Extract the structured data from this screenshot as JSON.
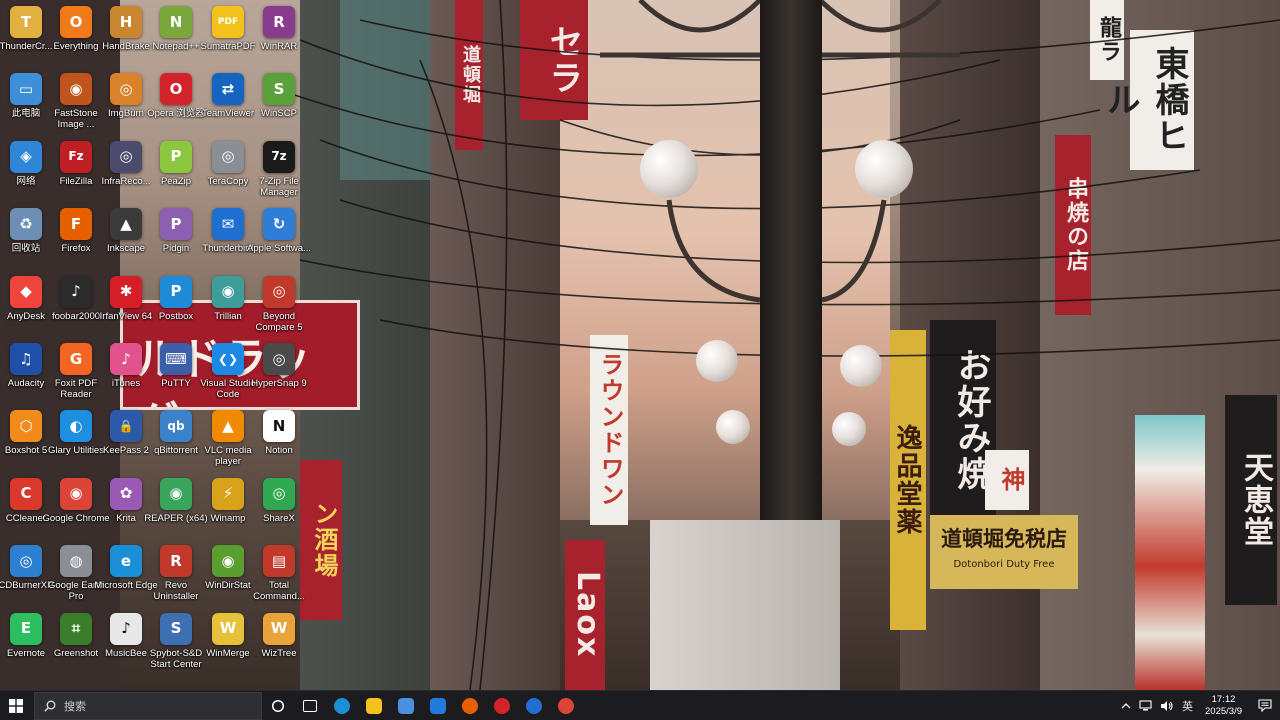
{
  "desktop": {
    "icons": [
      {
        "name": "ThunderCr...",
        "icon": "thundercr-icon",
        "color": "#e0b040",
        "glyph": "T"
      },
      {
        "name": "Everything",
        "icon": "everything-icon",
        "color": "#f07a1a",
        "glyph": "O"
      },
      {
        "name": "HandBrake",
        "icon": "handbrake-icon",
        "color": "#c9862f",
        "glyph": "H"
      },
      {
        "name": "Notepad++",
        "icon": "notepadpp-icon",
        "color": "#7aa83c",
        "glyph": "N"
      },
      {
        "name": "SumatraPDF",
        "icon": "sumatrapdf-icon",
        "color": "#f2c21b",
        "glyph": "PDF"
      },
      {
        "name": "WinRAR",
        "icon": "winrar-icon",
        "color": "#8a3c8c",
        "glyph": "R"
      },
      {
        "name": "此电脑",
        "icon": "this-pc-icon",
        "color": "#3f8fd8",
        "glyph": "▭"
      },
      {
        "name": "FastStone Image ...",
        "icon": "faststone-icon",
        "color": "#c0541e",
        "glyph": "◉"
      },
      {
        "name": "ImgBurn",
        "icon": "imgburn-icon",
        "color": "#d9822b",
        "glyph": "◎"
      },
      {
        "name": "Opera 浏览器",
        "icon": "opera-icon",
        "color": "#d2232a",
        "glyph": "O"
      },
      {
        "name": "TeamViewer",
        "icon": "teamviewer-icon",
        "color": "#1565c0",
        "glyph": "⇄"
      },
      {
        "name": "WinSCP",
        "icon": "winscp-icon",
        "color": "#5aa13c",
        "glyph": "S"
      },
      {
        "name": "网络",
        "icon": "network-icon",
        "color": "#2f86d6",
        "glyph": "◈"
      },
      {
        "name": "FileZilla",
        "icon": "filezilla-icon",
        "color": "#bf1e24",
        "glyph": "Fz"
      },
      {
        "name": "InfraReco...",
        "icon": "infrarecorder-icon",
        "color": "#4b4b6e",
        "glyph": "◎"
      },
      {
        "name": "PeaZip",
        "icon": "peazip-icon",
        "color": "#8cc63f",
        "glyph": "P"
      },
      {
        "name": "TeraCopy",
        "icon": "teracopy-icon",
        "color": "#8a8f96",
        "glyph": "◎"
      },
      {
        "name": "7-Zip File Manager",
        "icon": "sevenzip-icon",
        "color": "#1a1a1a",
        "glyph": "7z"
      },
      {
        "name": "回收站",
        "icon": "recycle-bin-icon",
        "color": "#6c8fb3",
        "glyph": "♻"
      },
      {
        "name": "Firefox",
        "icon": "firefox-icon",
        "color": "#e66000",
        "glyph": "F"
      },
      {
        "name": "Inkscape",
        "icon": "inkscape-icon",
        "color": "#3a3a3a",
        "glyph": "▲"
      },
      {
        "name": "Pidgin",
        "icon": "pidgin-icon",
        "color": "#8d5fb0",
        "glyph": "P"
      },
      {
        "name": "Thunderbird",
        "icon": "thunderbird-icon",
        "color": "#1f6fd0",
        "glyph": "✉"
      },
      {
        "name": "Apple Softwa...",
        "icon": "apple-software-update-icon",
        "color": "#2e7dd7",
        "glyph": "↻"
      },
      {
        "name": "AnyDesk",
        "icon": "anydesk-icon",
        "color": "#ef443b",
        "glyph": "◆"
      },
      {
        "name": "foobar2000",
        "icon": "foobar2000-icon",
        "color": "#2b2b2b",
        "glyph": "♪"
      },
      {
        "name": "IrfanView 64",
        "icon": "irfanview-icon",
        "color": "#d31f25",
        "glyph": "✱"
      },
      {
        "name": "Postbox",
        "icon": "postbox-icon",
        "color": "#1f8ad6",
        "glyph": "P"
      },
      {
        "name": "Trillian",
        "icon": "trillian-icon",
        "color": "#3e9c9a",
        "glyph": "◉"
      },
      {
        "name": "Beyond Compare 5",
        "icon": "beyond-compare-icon",
        "color": "#c0392b",
        "glyph": "◎"
      },
      {
        "name": "Audacity",
        "icon": "audacity-icon",
        "color": "#1f4fa8",
        "glyph": "♫"
      },
      {
        "name": "Foxit PDF Reader",
        "icon": "foxit-icon",
        "color": "#f26522",
        "glyph": "G"
      },
      {
        "name": "iTunes",
        "icon": "itunes-icon",
        "color": "#e2538e",
        "glyph": "♪"
      },
      {
        "name": "PuTTY",
        "icon": "putty-icon",
        "color": "#3c5fa8",
        "glyph": "⌨"
      },
      {
        "name": "Visual Studio Code",
        "icon": "vscode-icon",
        "color": "#1e88e5",
        "glyph": "❮❯"
      },
      {
        "name": "HyperSnap 9",
        "icon": "hypersnap-icon",
        "color": "#4a4a4a",
        "glyph": "◎"
      },
      {
        "name": "Boxshot 5",
        "icon": "boxshot-icon",
        "color": "#f08c1e",
        "glyph": "⬡"
      },
      {
        "name": "Glary Utilities",
        "icon": "glary-utilities-icon",
        "color": "#1c8fe0",
        "glyph": "◐"
      },
      {
        "name": "KeePass 2",
        "icon": "keepass-icon",
        "color": "#2c5aa8",
        "glyph": "🔒"
      },
      {
        "name": "qBittorrent",
        "icon": "qbittorrent-icon",
        "color": "#3b82c8",
        "glyph": "qb"
      },
      {
        "name": "VLC media player",
        "icon": "vlc-icon",
        "color": "#f08a00",
        "glyph": "▲"
      },
      {
        "name": "Notion",
        "icon": "notion-icon",
        "color": "#ffffff",
        "glyph": "N"
      },
      {
        "name": "CCleaner",
        "icon": "ccleaner-icon",
        "color": "#d9382b",
        "glyph": "C"
      },
      {
        "name": "Google Chrome",
        "icon": "chrome-icon",
        "color": "#db4437",
        "glyph": "◉"
      },
      {
        "name": "Krita",
        "icon": "krita-icon",
        "color": "#9b59b6",
        "glyph": "✿"
      },
      {
        "name": "REAPER (x64)",
        "icon": "reaper-icon",
        "color": "#3aa55c",
        "glyph": "◉"
      },
      {
        "name": "Winamp",
        "icon": "winamp-icon",
        "color": "#d9a21b",
        "glyph": "⚡"
      },
      {
        "name": "ShareX",
        "icon": "sharex-icon",
        "color": "#2fa84f",
        "glyph": "◎"
      },
      {
        "name": "CDBurnerXP",
        "icon": "cdburnerxp-icon",
        "color": "#2d7fd0",
        "glyph": "◎"
      },
      {
        "name": "Google Earth Pro",
        "icon": "google-earth-icon",
        "color": "#8a8f96",
        "glyph": "◍"
      },
      {
        "name": "Microsoft Edge",
        "icon": "edge-icon",
        "color": "#1b8fd6",
        "glyph": "e"
      },
      {
        "name": "Revo Uninstaller",
        "icon": "revo-uninstaller-icon",
        "color": "#c0392b",
        "glyph": "R"
      },
      {
        "name": "WinDirStat",
        "icon": "windirstat-icon",
        "color": "#5a9e2f",
        "glyph": "◉"
      },
      {
        "name": "Total Command...",
        "icon": "total-commander-icon",
        "color": "#c0392b",
        "glyph": "▤"
      },
      {
        "name": "Evernote",
        "icon": "evernote-icon",
        "color": "#2dbe60",
        "glyph": "E"
      },
      {
        "name": "Greenshot",
        "icon": "greenshot-icon",
        "color": "#3b7d2a",
        "glyph": "⌗"
      },
      {
        "name": "MusicBee",
        "icon": "musicbee-icon",
        "color": "#e8e8e8",
        "glyph": "♪"
      },
      {
        "name": "Spybot-S&D Start Center",
        "icon": "spybot-icon",
        "color": "#3e6fb0",
        "glyph": "S"
      },
      {
        "name": "WinMerge",
        "icon": "winmerge-icon",
        "color": "#e6c23b",
        "glyph": "W"
      },
      {
        "name": "WizTree",
        "icon": "wiztree-icon",
        "color": "#e8a33a",
        "glyph": "W"
      }
    ]
  },
  "wallpaper": {
    "signs": {
      "s1": "セラ",
      "s2": "東橋ヒル",
      "s3": "串焼の店",
      "s4": "お好み焼",
      "s5": "逸品堂薬",
      "s6": "天恵堂",
      "s7": "ラウンドワン",
      "s8": "Laox",
      "s9": "神",
      "s10": "龍ラ",
      "s11": "道頓堀",
      "s12": "ン酒場",
      "banner_main": "道頓堀免税店",
      "banner_sub": "Dotonbori Duty Free",
      "red_board": "ルドラッグ"
    }
  },
  "taskbar": {
    "search_placeholder": "搜索",
    "pinned": [
      {
        "name": "task-view",
        "icon": "task-view-icon",
        "color": "#ffffff"
      },
      {
        "name": "edge",
        "icon": "edge-icon",
        "color": "#1b8fd6"
      },
      {
        "name": "file-explorer",
        "icon": "folder-icon",
        "color": "#f2c21b"
      },
      {
        "name": "microsoft-store",
        "icon": "store-icon",
        "color": "#4a8fe0"
      },
      {
        "name": "mail",
        "icon": "mail-icon",
        "color": "#1f7ad9"
      },
      {
        "name": "firefox",
        "icon": "firefox-icon",
        "color": "#e66000"
      },
      {
        "name": "opera",
        "icon": "opera-icon",
        "color": "#d2232a"
      },
      {
        "name": "thunderbird",
        "icon": "thunderbird-icon",
        "color": "#1f6fd0"
      },
      {
        "name": "chrome",
        "icon": "chrome-icon",
        "color": "#db4437"
      }
    ],
    "tray": {
      "ime": "英",
      "time": "17:12",
      "date": "2025/3/9"
    }
  }
}
